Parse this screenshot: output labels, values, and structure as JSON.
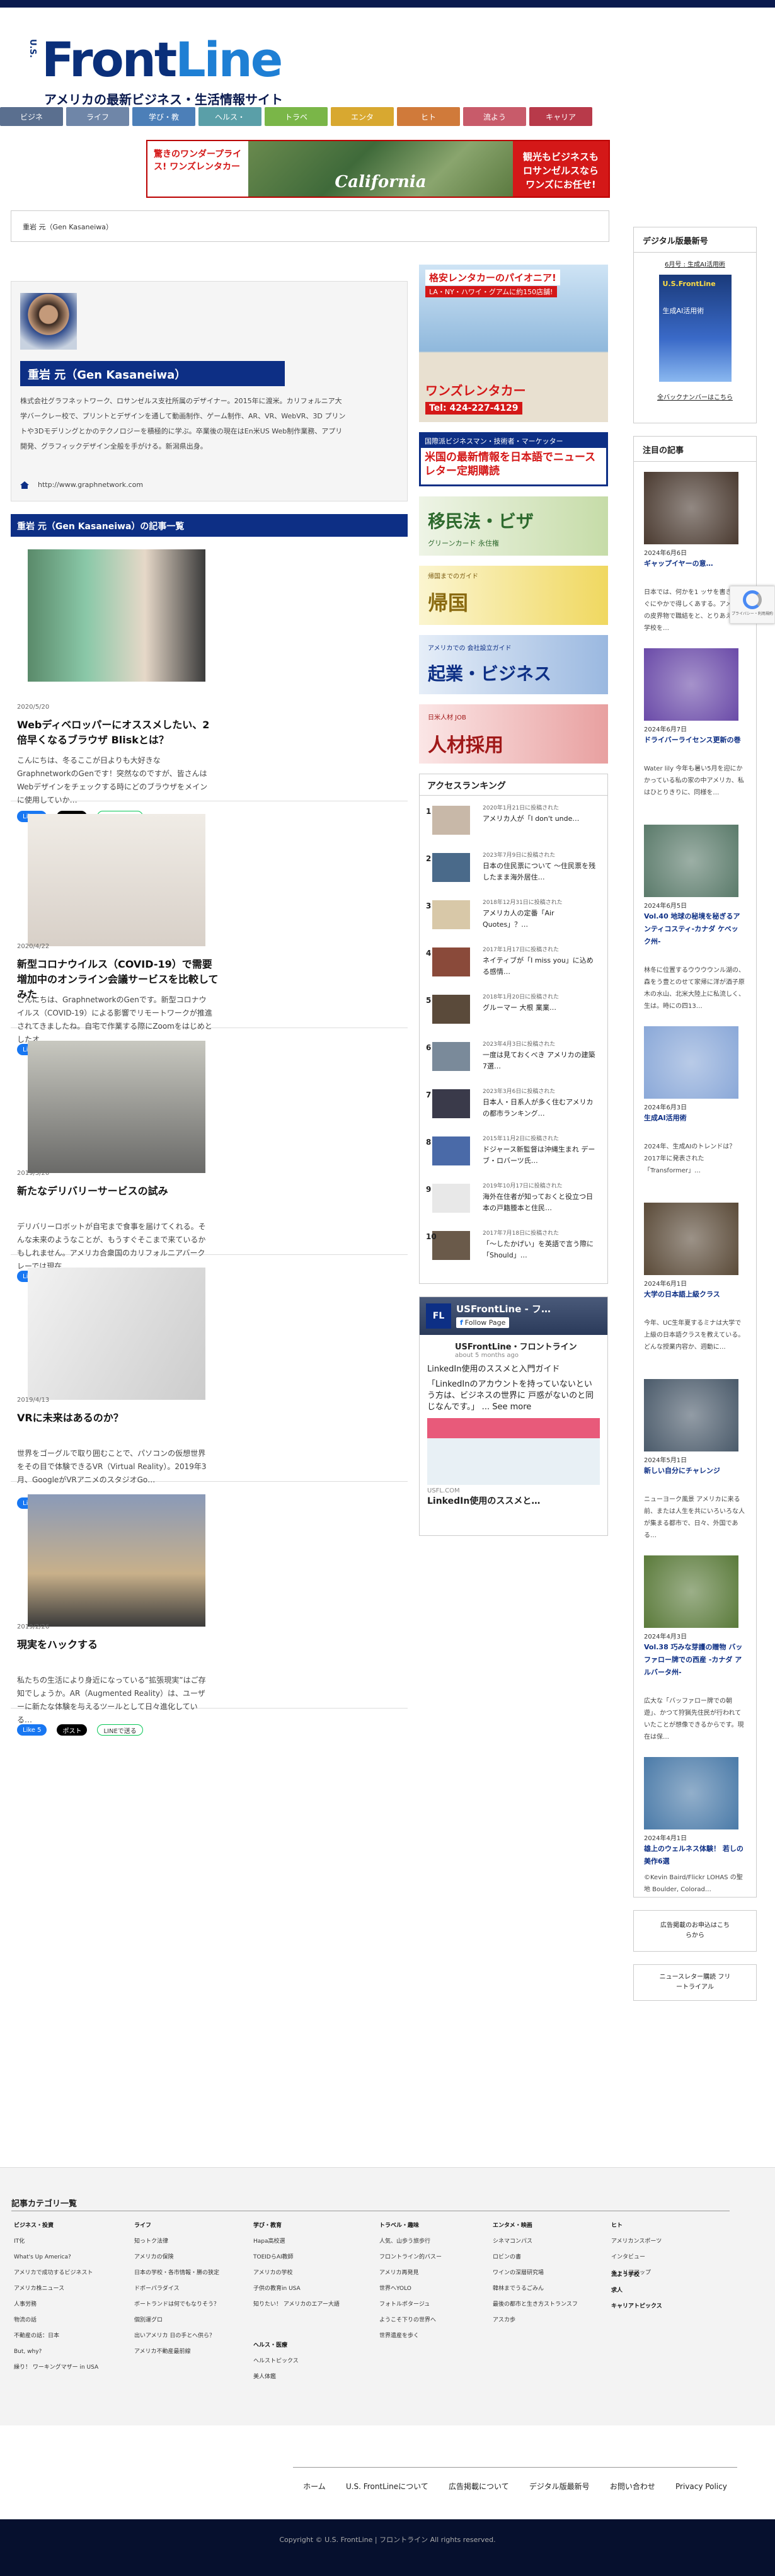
{
  "logo": {
    "us": "U.S.",
    "front": "Front",
    "line": "Line",
    "tagline": "アメリカの最新ビジネス・生活情報サイト"
  },
  "nav": [
    {
      "label": "ビジネ",
      "color": "#5a6f8f"
    },
    {
      "label": "ライフ",
      "color": "#6f86a8"
    },
    {
      "label": "学び・教",
      "color": "#4c7fb8"
    },
    {
      "label": "ヘルス・",
      "color": "#5a9fa8"
    },
    {
      "label": "トラベ",
      "color": "#7ab648"
    },
    {
      "label": "エンタ",
      "color": "#d8a830"
    },
    {
      "label": "ヒト",
      "color": "#d07a3a"
    },
    {
      "label": "流よう",
      "color": "#c85b6a"
    },
    {
      "label": "キャリア",
      "color": "#b83a4a"
    }
  ],
  "banner": {
    "left": "驚きのワンダープライス! ワンズレンタカー",
    "center": "California",
    "right": "観光もビジネスも ロサンゼルスなら ワンズにお任せ!"
  },
  "breadcrumb": "重岩 元（Gen Kasaneiwa）",
  "author": {
    "name": "重岩 元（Gen Kasaneiwa）",
    "description": "株式会社グラフネットワーク、ロサンゼルス支社所属のデザイナー。2015年に渡米。カリフォルニア大学バークレー校で、プリントとデザインを通して動画制作、ゲーム制作、AR、VR、WebVR、3D プリントや3Dモデリングとかのテクノロジーを積極的に学ぶ。卒業後の現在はEn米US Web制作業務、アプリ開発、グラフィックデザイン全般を手がける。新潟県出身。",
    "link": "http://www.graphnetwork.com"
  },
  "section_title": "重岩 元（Gen Kasaneiwa）の記事一覧",
  "articles": [
    {
      "date": "2020/5/20",
      "title": "Webディベロッパーにオススメしたい、2倍早くなるブラウザ Bliskとは？",
      "excerpt": "こんにちは、冬るここが日よりも大好きなGraphnetworkのGenです！突然なのですが、皆さんはWebデザインをチェックする時にどのブラウザをメインに使用していか…",
      "fb": "Like 1"
    },
    {
      "date": "2020/4/22",
      "title": "新型コロナウイルス（COVID-19）で需要増加中のオンライン会議サービスを比較してみた",
      "excerpt": "こんにちは、GraphnetworkのGenです。新型コロナウイルス（COVID-19）による影響でリモートワークが推進されてきましたね。自宅で作業する際にZoomをはじめとしたオ…",
      "fb": "Like 2"
    },
    {
      "date": "2019/5/20",
      "title": "新たなデリバリーサービスの試み",
      "excerpt": "デリバリーロボットが自宅まで食事を届けてくれる。そんな未来のようなことが、もうすぐそこまで来ているかもしれません。アメリカ合衆国のカリフォルニアバークレーでは現在…",
      "fb": "Like 5"
    },
    {
      "date": "2019/4/13",
      "title": "VRに未来はあるのか？",
      "excerpt": "世界をゴーグルで取り囲むことで、パソコンの仮想世界をその目で体験できるVR（Virtual Reality）。2019年3月、GoogleがVRアニメのスタジオGo…",
      "fb": "Like 5"
    },
    {
      "date": "2019/2/26",
      "title": "現実をハックする",
      "excerpt": "私たちの生活により身近になっている”拡張現実”はご存知でしょうか。AR（Augmented Reality）は、ユーザーに新たな体験を与えるツールとして日々進化している…",
      "fb": "Like 5"
    }
  ],
  "share": {
    "x": "ポスト",
    "line": "LINEで送る"
  },
  "mid_ads": [
    {
      "title": "格安レンタカーのパイオニア!",
      "sub": "LA・NY・ハワイ・グアムに約150店舗!",
      "brand": "ワンズレンタカー",
      "tel": "Tel: 424-227-4129"
    },
    {
      "title": "国際派ビジネスマン・技術者・マーケッター",
      "sub": "米国の最新情報を日本語でニュースレター定期購読"
    },
    {
      "title": "移民法・ビザ",
      "sub": "グリーンカード 永住権"
    },
    {
      "title": "帰国",
      "sub": "帰国までのガイド"
    },
    {
      "title": "起業・ビジネス",
      "sub": "アメリカでの 会社設立ガイド"
    },
    {
      "title": "人材採用",
      "sub": "日米人材 JOB"
    }
  ],
  "ranking": {
    "title": "アクセスランキング",
    "items": [
      {
        "num": "1",
        "date": "2020年1月21日に投稿された",
        "title": "アメリカ人が「I don't unde…"
      },
      {
        "num": "2",
        "date": "2023年7月9日に投稿された",
        "title": "日本の住民票について 〜住民票を残したまま海外居住…"
      },
      {
        "num": "3",
        "date": "2018年12月31日に投稿された",
        "title": "アメリカ人の定番「Air Quotes」？…"
      },
      {
        "num": "4",
        "date": "2017年1月17日に投稿された",
        "title": "ネイティブが「I miss you」に込める感情…"
      },
      {
        "num": "5",
        "date": "2018年1月20日に投稿された",
        "title": "グルーマー 大根 業業…"
      },
      {
        "num": "6",
        "date": "2023年4月3日に投稿された",
        "title": "一度は見ておくべき アメリカの建築7選…"
      },
      {
        "num": "7",
        "date": "2023年3月6日に投稿された",
        "title": "日本人・日系人が多く住むアメリカの都市ランキング…"
      },
      {
        "num": "8",
        "date": "2015年11月2日に投稿された",
        "title": "ドジャース新監督は沖縄生まれ デーブ・ロバーツ氏…"
      },
      {
        "num": "9",
        "date": "2019年10月17日に投稿された",
        "title": "海外在住者が知っておくと役立つ日本の戸籍謄本と住民…"
      },
      {
        "num": "10",
        "date": "2017年7月18日に投稿された",
        "title": "「〜したかげい」を英語で言う際に「Should」…"
      }
    ]
  },
  "fb_box": {
    "page": "USFrontLine - フ…",
    "follow": "Follow Page",
    "name": "USFrontLine・フロントライン",
    "time": "about 5 months ago",
    "post_title": "LinkedIn使用のススメと入門ガイド",
    "post_body": "「LinkedInのアカウントを持っていないという方は、ビジネスの世界に 戸惑がないのと同じなんです。」 ... See more",
    "domain": "USFL.COM",
    "card_title": "LinkedIn使用のススメと…"
  },
  "digital": {
    "title": "デジタル版最新号",
    "issue": "6月号 : 生成AI活用術",
    "cover_title": "U.S.FrontLine",
    "cover_sub": "生成AI活用術",
    "link": "全バックナンバーはこちら"
  },
  "featured": {
    "title": "注目の記事",
    "items": [
      {
        "date": "2024年6月6日",
        "title": "ギャップイヤーの意…",
        "excerpt": "日本では、何かを1 ッサを書き、すぐにやかで得しくあする。アメリカの皮界物で職結をと、とりあえず、学校を…",
        "color": "#4a3a30"
      },
      {
        "date": "2024年6月7日",
        "title": "ドライバーライセンス更新の巻",
        "excerpt": "Water lily 今年も暑い5月を迎にかかっている私の家の中アメリカ、私はひとりきりに、同様を…",
        "color": "#6a4aa8"
      },
      {
        "date": "2024年6月5日",
        "title": "Vol.40 地球の秘境を秘ぎるアンティコスティ-カナダ ケベック州-",
        "excerpt": "林冬に位置するウウウウンル湖の、森をう豊とのせて家帰に洋が酒子原木の水山、北米大陸上に私流しく、生は。時にの四13…",
        "color": "#5a7a6a"
      },
      {
        "date": "2024年6月3日",
        "title": "生成AI活用術",
        "excerpt": "2024年、生成AIのトレンドは？ 2017年に発表された「Transformer」…",
        "color": "#8aa8d8"
      },
      {
        "date": "2024年6月1日",
        "title": "大学の日本語上級クラス",
        "excerpt": "今年、UC生年夏するミナは大学で上級の日本語クラスを教えている。どんな授業内容か、週動に…",
        "color": "#5a4a38"
      },
      {
        "date": "2024年5月1日",
        "title": "新しい自分にチャレンジ",
        "excerpt": "ニューヨーク風景 アメリカに来る前、または人生を共にいろいろな人が集まる都市で、日々、外国である…",
        "color": "#4a5a6a"
      },
      {
        "date": "2024年4月3日",
        "title": "Vol.38 巧みな芽護の贈物 バッファロー牌での西産 -カナダ アルバータ州-",
        "excerpt": "広大な「バッファロー牌での朝遊」、かつて狩猟先住民が行われていたことが想像できるからです。現在は保…",
        "color": "#5a7a3a"
      },
      {
        "date": "2024年4月1日",
        "title": "雄上のウェルネス体験！ 若しの美作6選",
        "excerpt": "©Kevin Baird/Flickr LOHAS の聖地 Boulder, Colorad…",
        "color": "#4a7aa8"
      }
    ]
  },
  "side_links": [
    {
      "label": "広告掲載のお申込はこちらから"
    },
    {
      "label": "ニュースレター購読 フリートライアル"
    }
  ],
  "footer_cats": {
    "title": "記事カテゴリ一覧",
    "cols": [
      {
        "h": "ビジネス・投資",
        "items": [
          "IT化",
          "What's Up America?",
          "アメリカで成功するビジネスト",
          "アメリカ株ニュース",
          "人事労務",
          "物流の話",
          "不動産の話：日本",
          "But, why?",
          "繰り！ ワーキングマザー in USA"
        ]
      },
      {
        "h": "ライフ",
        "items": [
          "知っトク法律",
          "アメリカの保険",
          "日本の学校・各市情報・勝の狭定",
          "ドボーパラダイス",
          "ボートランドは何でもなりそう？",
          "個別運グロ",
          "出いアメリカ 日の手とへ供ら？",
          "アメリカ不動産最前線"
        ]
      },
      {
        "h": "学び・教育",
        "items": [
          "Hapa高校選",
          "TOEIDらAI教師",
          "アメリカの学校",
          "子供の教育in USA",
          "知りたい！ アメリカのエアー大語"
        ]
      },
      {
        "h": "トラベル・趣味",
        "items": [
          "人気、山歩う旅歩行",
          "フロントライン的バスー",
          "アメリカ再発見",
          "世界へYOLO",
          "フォトルポタージュ",
          "ようこそ下りの世界へ",
          "世界遺産を歩く"
        ]
      },
      {
        "h": "エンタメ・映画",
        "items": [
          "シネマコンパス",
          "ロビンの書",
          "ワインの深層研究場",
          "韓林までうるごみん",
          "最後の都市と生き方ストランスフ",
          "アスカ歩"
        ]
      },
      {
        "h": "ヒト",
        "items": [
          "アメリカンスポーツ",
          "インタビュー",
          "キャリアアップ"
        ]
      }
    ],
    "extra_h1": "ヘルス・医療",
    "extra_items1": [
      "ヘルストピックス",
      "美人体鑑"
    ],
    "extra_h2": "流よう学校",
    "extra_h3": "求人",
    "extra_h4": "キャリアトピックス"
  },
  "footer_nav": [
    "ホーム",
    "U.S. FrontLineについて",
    "広告掲載について",
    "デジタル版最新号",
    "お問い合わせ",
    "Privacy Policy"
  ],
  "copyright": "Copyright © U.S. FrontLine | フロントライン All rights reserved.",
  "recaptcha": "プライバシー・利用規約"
}
